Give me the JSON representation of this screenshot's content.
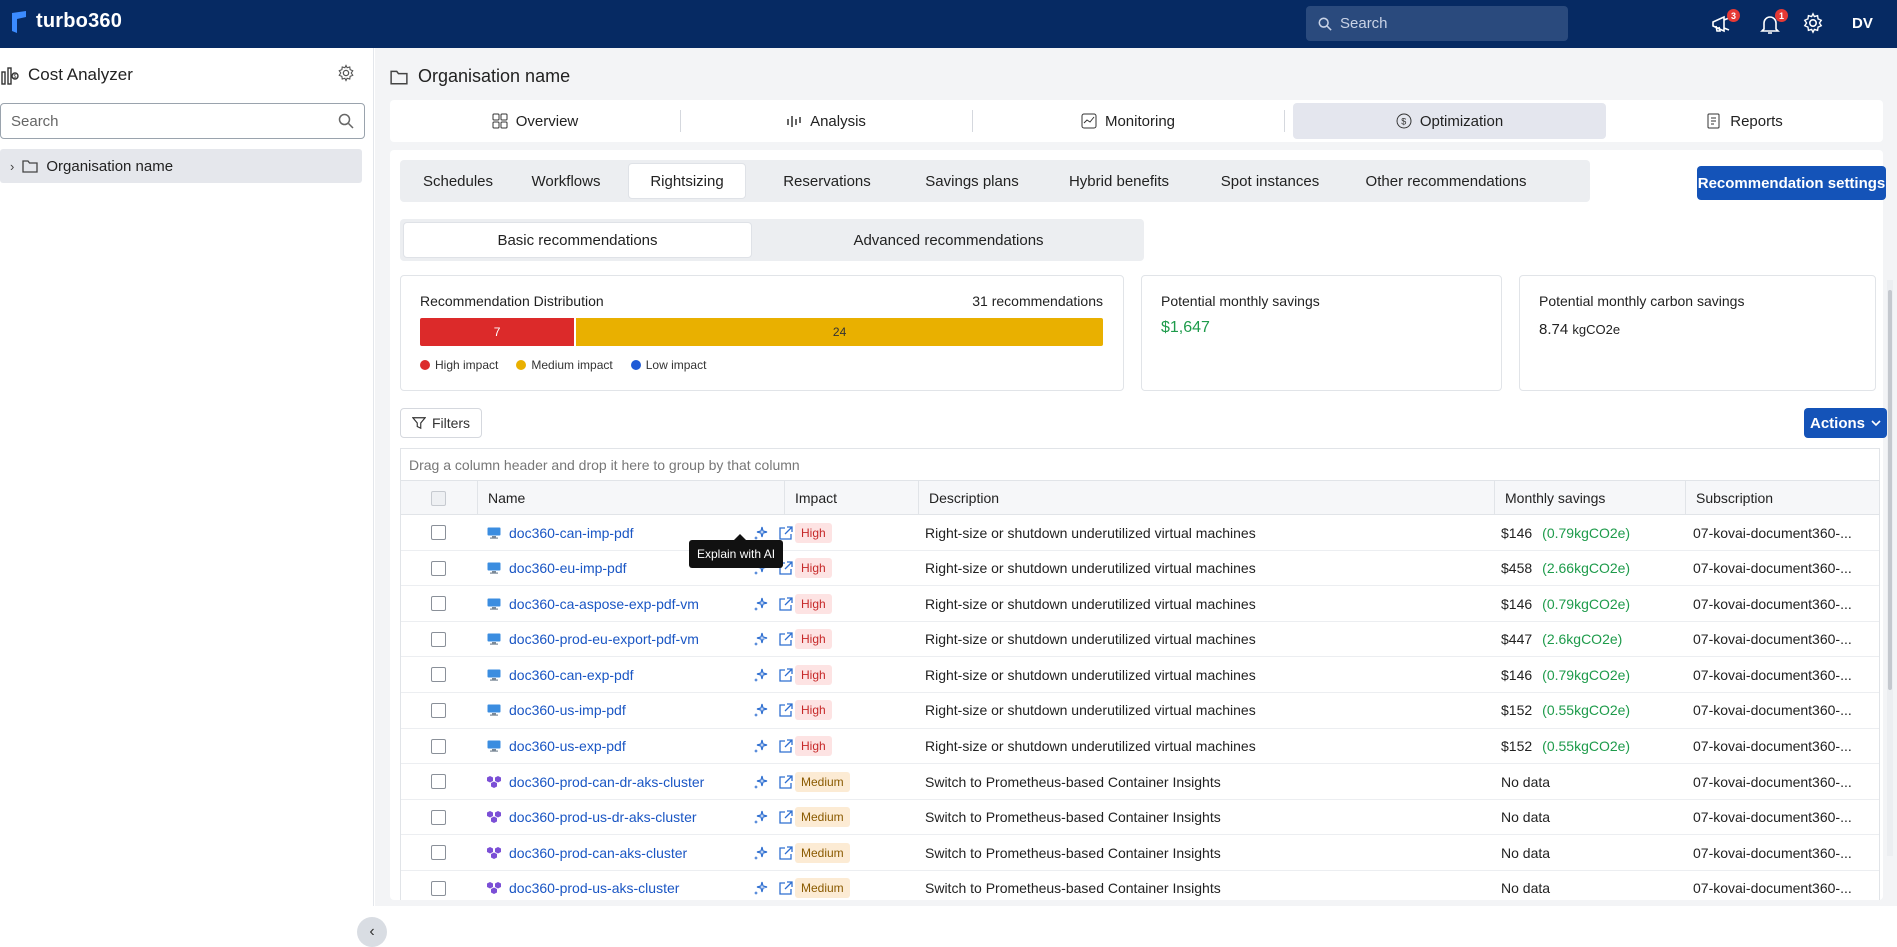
{
  "app": {
    "name": "turbo360",
    "search_placeholder": "Search",
    "avatar_initials": "DV",
    "notifications_count": "3",
    "alerts_count": "1"
  },
  "sidebar": {
    "title": "Cost Analyzer",
    "search_placeholder": "Search",
    "tree_item": "Organisation name"
  },
  "page": {
    "org_name": "Organisation name"
  },
  "nav_tabs": [
    "Overview",
    "Analysis",
    "Monitoring",
    "Optimization",
    "Reports"
  ],
  "sub_tabs": [
    "Schedules",
    "Workflows",
    "Rightsizing",
    "Reservations",
    "Savings plans",
    "Hybrid benefits",
    "Spot instances",
    "Other recommendations"
  ],
  "recommendation_settings_label": "Recommendation settings",
  "toggle": {
    "basic": "Basic recommendations",
    "advanced": "Advanced recommendations"
  },
  "distribution": {
    "title": "Recommendation Distribution",
    "count_label": "31 recommendations",
    "high_value": 7,
    "medium_value": 24,
    "high_label": "7",
    "medium_label": "24",
    "legend_high": "High impact",
    "legend_medium": "Medium impact",
    "legend_low": "Low impact",
    "colors": {
      "high": "#dc2a2a",
      "medium": "#e9b000",
      "low": "#1e5ad6"
    }
  },
  "savings": {
    "monthly_label": "Potential monthly savings",
    "monthly_value": "$1,647",
    "carbon_label": "Potential monthly carbon savings",
    "carbon_value": "8.74",
    "carbon_unit": "kgCO2e"
  },
  "filters_label": "Filters",
  "actions_label": "Actions",
  "grid": {
    "group_hint": "Drag a column header and drop it here to group by that column",
    "columns": [
      "Name",
      "Impact",
      "Description",
      "Monthly savings",
      "Subscription"
    ],
    "tooltip": "Explain with AI",
    "rows": [
      {
        "name": "doc360-can-imp-pdf",
        "type": "vm",
        "impact": "High",
        "description": "Right-size or shutdown underutilized virtual machines",
        "savings": "$146",
        "carbon": "(0.79kgCO2e)",
        "subscription": "07-kovai-document360-..."
      },
      {
        "name": "doc360-eu-imp-pdf",
        "type": "vm",
        "impact": "High",
        "description": "Right-size or shutdown underutilized virtual machines",
        "savings": "$458",
        "carbon": "(2.66kgCO2e)",
        "subscription": "07-kovai-document360-..."
      },
      {
        "name": "doc360-ca-aspose-exp-pdf-vm",
        "type": "vm",
        "impact": "High",
        "description": "Right-size or shutdown underutilized virtual machines",
        "savings": "$146",
        "carbon": "(0.79kgCO2e)",
        "subscription": "07-kovai-document360-..."
      },
      {
        "name": "doc360-prod-eu-export-pdf-vm",
        "type": "vm",
        "impact": "High",
        "description": "Right-size or shutdown underutilized virtual machines",
        "savings": "$447",
        "carbon": "(2.6kgCO2e)",
        "subscription": "07-kovai-document360-..."
      },
      {
        "name": "doc360-can-exp-pdf",
        "type": "vm",
        "impact": "High",
        "description": "Right-size or shutdown underutilized virtual machines",
        "savings": "$146",
        "carbon": "(0.79kgCO2e)",
        "subscription": "07-kovai-document360-..."
      },
      {
        "name": "doc360-us-imp-pdf",
        "type": "vm",
        "impact": "High",
        "description": "Right-size or shutdown underutilized virtual machines",
        "savings": "$152",
        "carbon": "(0.55kgCO2e)",
        "subscription": "07-kovai-document360-..."
      },
      {
        "name": "doc360-us-exp-pdf",
        "type": "vm",
        "impact": "High",
        "description": "Right-size or shutdown underutilized virtual machines",
        "savings": "$152",
        "carbon": "(0.55kgCO2e)",
        "subscription": "07-kovai-document360-..."
      },
      {
        "name": "doc360-prod-can-dr-aks-cluster",
        "type": "aks",
        "impact": "Medium",
        "description": "Switch to Prometheus-based Container Insights",
        "savings": "No data",
        "carbon": "",
        "subscription": "07-kovai-document360-..."
      },
      {
        "name": "doc360-prod-us-dr-aks-cluster",
        "type": "aks",
        "impact": "Medium",
        "description": "Switch to Prometheus-based Container Insights",
        "savings": "No data",
        "carbon": "",
        "subscription": "07-kovai-document360-..."
      },
      {
        "name": "doc360-prod-can-aks-cluster",
        "type": "aks",
        "impact": "Medium",
        "description": "Switch to Prometheus-based Container Insights",
        "savings": "No data",
        "carbon": "",
        "subscription": "07-kovai-document360-..."
      },
      {
        "name": "doc360-prod-us-aks-cluster",
        "type": "aks",
        "impact": "Medium",
        "description": "Switch to Prometheus-based Container Insights",
        "savings": "No data",
        "carbon": "",
        "subscription": "07-kovai-document360-..."
      }
    ]
  }
}
